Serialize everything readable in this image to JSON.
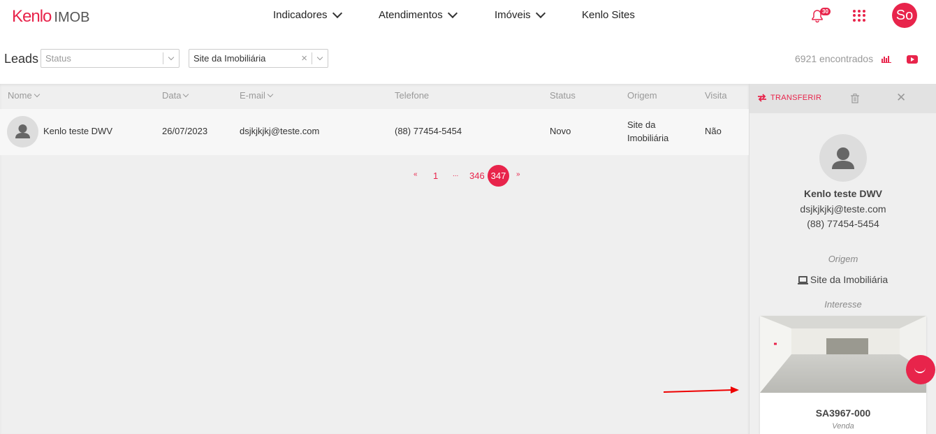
{
  "brand": {
    "name": "Kenlo",
    "product": "IMOB",
    "accent": "#e8244b"
  },
  "nav": [
    {
      "label": "Indicadores",
      "has_dropdown": true
    },
    {
      "label": "Atendimentos",
      "has_dropdown": true
    },
    {
      "label": "Imóveis",
      "has_dropdown": true
    },
    {
      "label": "Kenlo Sites",
      "has_dropdown": false
    }
  ],
  "notifications": {
    "count": "30",
    "icon": "bell-icon"
  },
  "user": {
    "initials": "So"
  },
  "filters": {
    "page_label": "Leads",
    "status_placeholder": "Status",
    "origin_value": "Site da Imobiliária",
    "found_text": "6921 encontrados"
  },
  "table": {
    "columns": [
      "Nome",
      "Data",
      "E-mail",
      "Telefone",
      "Status",
      "Origem",
      "Visita"
    ],
    "rows": [
      {
        "nome": "Kenlo teste DWV",
        "data": "26/07/2023",
        "email": "dsjkjkjkj@teste.com",
        "telefone": "(88) 77454-5454",
        "status": "Novo",
        "origem_line1": "Site da",
        "origem_line2": "Imobiliária",
        "visita": "Não"
      }
    ]
  },
  "pagination": {
    "prev": "«",
    "first": "1",
    "ellipsis": "...",
    "p346": "346",
    "current": "347",
    "next": "»"
  },
  "panel": {
    "transfer_label": "TRANSFERIR",
    "lead_name": "Kenlo teste DWV",
    "lead_email": "dsjkjkjkj@teste.com",
    "lead_phone": "(88) 77454-5454",
    "origin_title": "Origem",
    "origin_value": "Site da Imobiliária",
    "interest_title": "Interesse",
    "property_code": "SA3967-000",
    "property_type": "Venda"
  }
}
